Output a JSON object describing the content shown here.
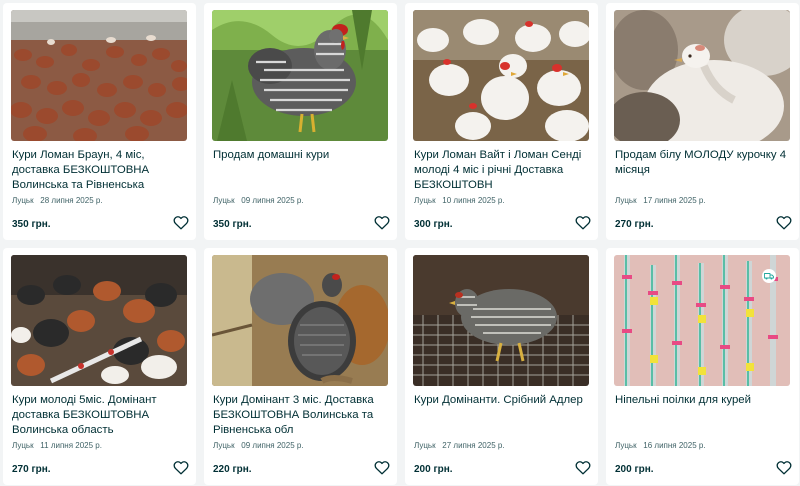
{
  "listings": [
    {
      "title": "Кури Ломан Браун, 4 міс, доставка БЕЗКОШТОВНА Волинська та Рівненська",
      "location": "Луцьк",
      "date": "28 липня 2025 р.",
      "price": "350 грн.",
      "image": "flock-brown-hens"
    },
    {
      "title": "Продам домашні кури",
      "location": "Луцьк",
      "date": "09 липня 2025 р.",
      "price": "350 грн.",
      "image": "barred-hen-grass"
    },
    {
      "title": "Кури Ломан Вайт і Ломан Сенді молоді 4 міс і річні Доставка БЕЗКОШТОВН",
      "location": "Луцьк",
      "date": "10 липня 2025 р.",
      "price": "300 грн.",
      "image": "white-hens"
    },
    {
      "title": "Продам білу МОЛОДУ курочку 4 місяця",
      "location": "Луцьк",
      "date": "17 липня 2025 р.",
      "price": "270 грн.",
      "image": "white-pullet-closeup"
    },
    {
      "title": "Кури молоді 5міс. Домінант доставка БЕЗКОШТОВНА Волинська область",
      "location": "Луцьк",
      "date": "11 липня 2025 р.",
      "price": "270 грн.",
      "image": "mixed-flock-barn"
    },
    {
      "title": "Кури Домінант 3 міс. Доставка БЕЗКОШТОВНА Волинська та Рівненська обл",
      "location": "Луцьк",
      "date": "09 липня 2025 р.",
      "price": "220 грн.",
      "image": "grey-hens-straw"
    },
    {
      "title": "Кури Домінанти. Срібний Адлер",
      "location": "Луцьк",
      "date": "27 липня 2025 р.",
      "price": "200 грн.",
      "image": "silver-hen-cage"
    },
    {
      "title": "Нiпельнi поiлки для курей",
      "location": "Луцьк",
      "date": "16 липня 2025 р.",
      "price": "200 грн.",
      "image": "nipple-drinkers",
      "delivery_icon": "delivery-truck-icon"
    }
  ],
  "icons": {
    "favorite": "heart-outline-icon",
    "delivery": "delivery-truck-icon"
  },
  "colors": {
    "background": "#f2f4f5",
    "card": "#ffffff",
    "text": "#002f34",
    "meta": "#406367",
    "delivery_badge": "#23e5db"
  }
}
